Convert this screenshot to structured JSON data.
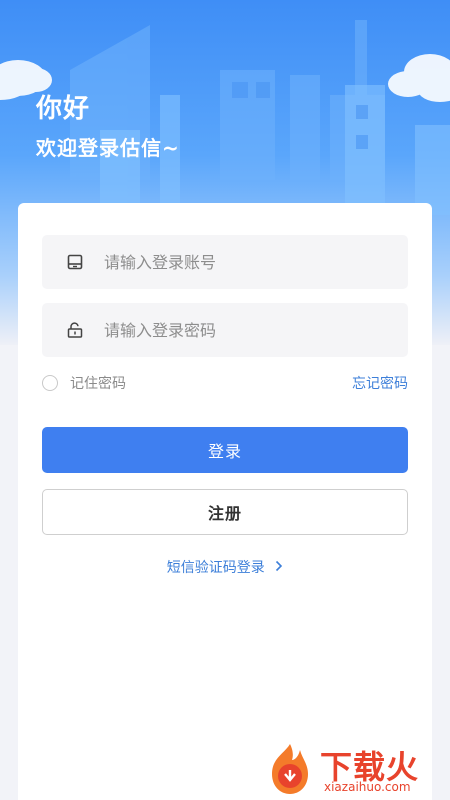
{
  "header": {
    "greeting": "你好",
    "welcome": "欢迎登录估信~"
  },
  "form": {
    "account_placeholder": "请输入登录账号",
    "account_icon": "phone-icon",
    "password_placeholder": "请输入登录密码",
    "password_icon": "lock-icon",
    "remember_label": "记住密码",
    "forgot_label": "忘记密码",
    "login_label": "登录",
    "register_label": "注册",
    "sms_login_label": "短信验证码登录"
  },
  "watermark": {
    "brand": "下载火",
    "domain": "xiazaihuo.com"
  },
  "colors": {
    "primary": "#3f7ff0",
    "link": "#3d7fd9",
    "hero_top": "#3f8ef6"
  }
}
